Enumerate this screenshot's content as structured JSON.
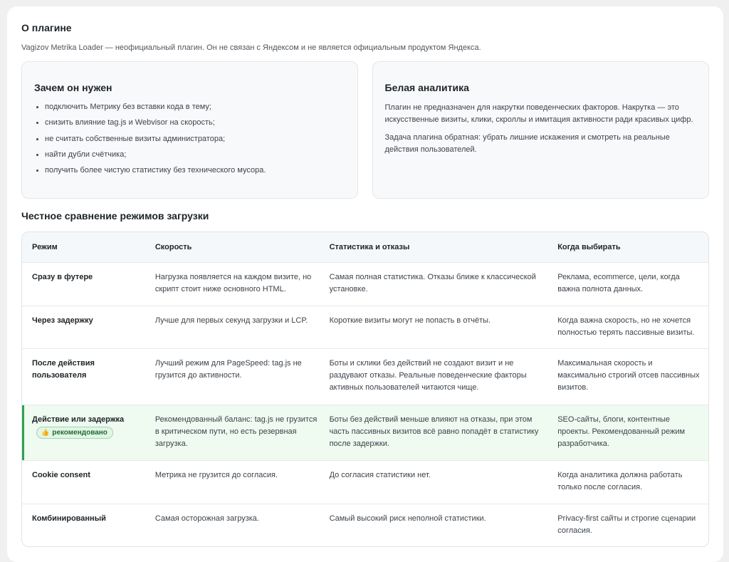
{
  "about": {
    "title": "О плагине",
    "description": "Vagizov Metrika Loader — неофициальный плагин. Он не связан с Яндексом и не является официальным продуктом Яндекса."
  },
  "why_card": {
    "title": "Зачем он нужен",
    "items": [
      "подключить Метрику без вставки кода в тему;",
      "снизить влияние tag.js и Webvisor на скорость;",
      "не считать собственные визиты администратора;",
      "найти дубли счётчика;",
      "получить более чистую статистику без технического мусора."
    ]
  },
  "white_card": {
    "title": "Белая аналитика",
    "p1": "Плагин не предназначен для накрутки поведенческих факторов. Накрутка — это искусственные визиты, клики, скроллы и имитация активности ради красивых цифр.",
    "p2": "Задача плагина обратная: убрать лишние искажения и смотреть на реальные действия пользователей."
  },
  "comparison": {
    "title": "Честное сравнение режимов загрузки",
    "headers": [
      "Режим",
      "Скорость",
      "Статистика и отказы",
      "Когда выбирать"
    ],
    "badge": {
      "icon": "thumbs-up-icon",
      "label": "рекомендовано"
    },
    "rows": [
      [
        "Сразу в футере",
        "Нагрузка появляется на каждом визите, но скрипт стоит ниже основного HTML.",
        "Самая полная статистика. Отказы ближе к классической установке.",
        "Реклама, ecommerce, цели, когда важна полнота данных."
      ],
      [
        "Через задержку",
        "Лучше для первых секунд загрузки и LCP.",
        "Короткие визиты могут не попасть в отчёты.",
        "Когда важна скорость, но не хочется полностью терять пассивные визиты."
      ],
      [
        "После действия пользователя",
        "Лучший режим для PageSpeed: tag.js не грузится до активности.",
        "Боты и склики без действий не создают визит и не раздувают отказы. Реальные поведенческие факторы активных пользователей читаются чище.",
        "Максимальная скорость и максимально строгий отсев пассивных визитов."
      ],
      [
        "Действие или задержка",
        "Рекомендованный баланс: tag.js не грузится в критическом пути, но есть резервная загрузка.",
        "Боты без действий меньше влияют на отказы, при этом часть пассивных визитов всё равно попадёт в статистику после задержки.",
        "SEO-сайты, блоги, контентные проекты. Рекомендованный режим разработчика."
      ],
      [
        "Cookie consent",
        "Метрика не грузится до согласия.",
        "До согласия статистики нет.",
        "Когда аналитика должна работать только после согласия."
      ],
      [
        "Комбинированный",
        "Самая осторожная загрузка.",
        "Самый высокий риск неполной статистики.",
        "Privacy-first сайты и строгие сценарии согласия."
      ]
    ]
  }
}
